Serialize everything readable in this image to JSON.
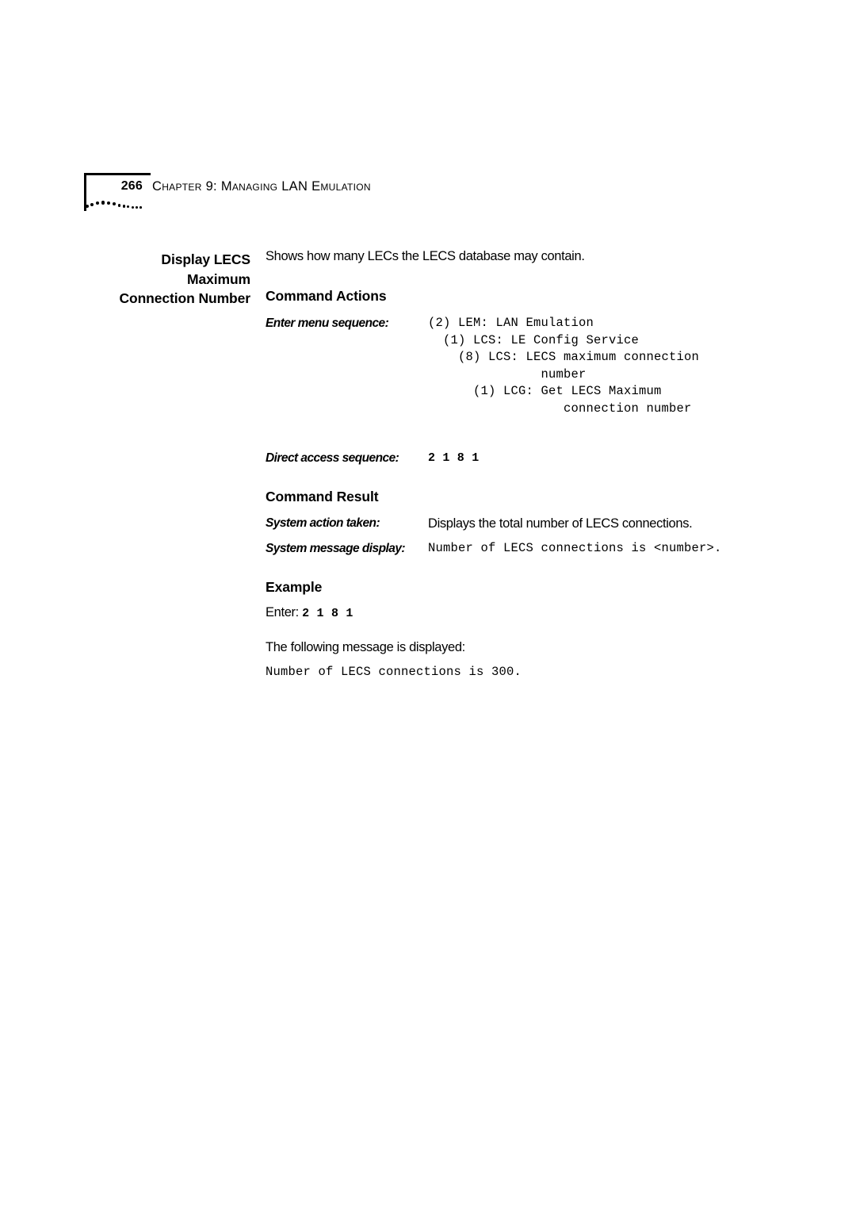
{
  "header": {
    "page_number": "266",
    "chapter_title": "Chapter 9: Managing LAN Emulation"
  },
  "side_heading": {
    "line1": "Display LECS",
    "line2": "Maximum",
    "line3": "Connection Number"
  },
  "body": {
    "intro": "Shows how many LECs the LECS database may contain.",
    "command_actions": {
      "heading": "Command Actions",
      "enter_menu_sequence_label": "Enter menu sequence:",
      "menu_sequence": "(2) LEM: LAN Emulation\n  (1) LCS: LE Config Service\n    (8) LCS: LECS maximum connection\n               number\n      (1) LCG: Get LECS Maximum\n                  connection number",
      "direct_access_label": "Direct access sequence:",
      "direct_access_value": "2 1 8 1"
    },
    "command_result": {
      "heading": "Command Result",
      "system_action_label": "System action taken:",
      "system_action_value": "Displays the total number of LECS connections.",
      "system_message_label": "System message display:",
      "system_message_value": "Number of LECS connections is <number>."
    },
    "example": {
      "heading": "Example",
      "enter_label": "Enter:",
      "enter_value": "2 1 8 1",
      "following_message": "The following message is displayed:",
      "output": "Number of LECS connections is 300."
    }
  }
}
